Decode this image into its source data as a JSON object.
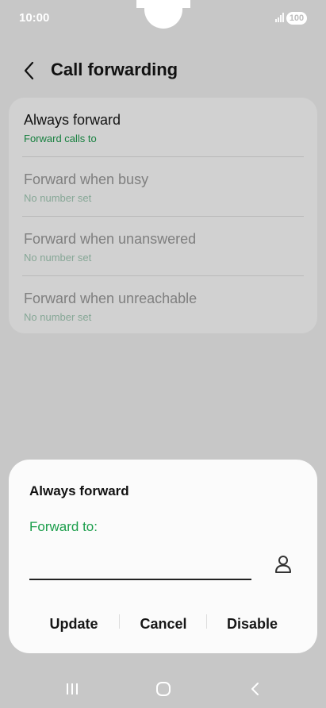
{
  "status_bar": {
    "time": "10:00",
    "battery": "100",
    "icons": [
      "signal-icon",
      "battery-icon"
    ]
  },
  "header": {
    "title": "Call forwarding",
    "back_icon": "chevron-left-icon"
  },
  "options": [
    {
      "label": "Always forward",
      "sub": "Forward calls to"
    },
    {
      "label": "Forward when busy",
      "sub": "No number set"
    },
    {
      "label": "Forward when unanswered",
      "sub": "No number set"
    },
    {
      "label": "Forward when unreachable",
      "sub": "No number set"
    }
  ],
  "dialog": {
    "title": "Always forward",
    "field_label": "Forward to:",
    "input_value": "",
    "contact_icon": "person-icon",
    "buttons": {
      "update": "Update",
      "cancel": "Cancel",
      "disable": "Disable"
    }
  },
  "nav_bar": {
    "icons": [
      "recent-apps-icon",
      "home-icon",
      "back-icon"
    ]
  },
  "colors": {
    "accent_green": "#1b9e4b",
    "subtitle_green": "#17803f",
    "scrim": "#c7c7c7",
    "dialog_bg": "#fbfbfb"
  }
}
